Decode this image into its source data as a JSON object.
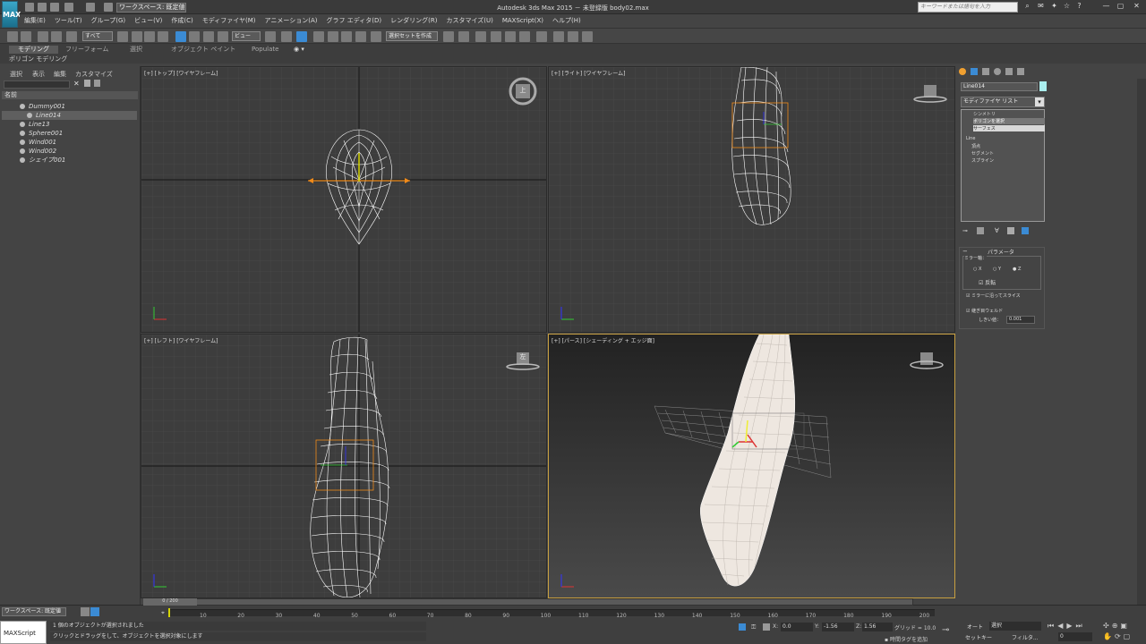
{
  "titlebar": {
    "title": "Autodesk 3ds Max  2015  －  未登録版      body02.max",
    "workspace": "ワークスペース: 既定値",
    "search_placeholder": "キーワードまたは語句を入力",
    "logo": "MAX"
  },
  "menu": [
    "編集(E)",
    "ツール(T)",
    "グループ(G)",
    "ビュー(V)",
    "作成(C)",
    "モディファイヤ(M)",
    "アニメーション(A)",
    "グラフ エディタ(D)",
    "レンダリング(R)",
    "カスタマイズ(U)",
    "MAXScript(X)",
    "ヘルプ(H)"
  ],
  "toolbar": {
    "filter": "すべて",
    "view": "ビュー",
    "selset": "選択セットを作成"
  },
  "ribbon": {
    "tabs": [
      "モデリング",
      "フリーフォーム",
      "選択",
      "オブジェクト ペイント",
      "Populate"
    ],
    "sub": "ポリゴン モデリング"
  },
  "scene": {
    "tabs": [
      "選択",
      "表示",
      "編集",
      "カスタマイズ"
    ],
    "header": "名前",
    "items": [
      {
        "name": "Dummy001"
      },
      {
        "name": "Line014"
      },
      {
        "name": "Line13"
      },
      {
        "name": "Sphere001"
      },
      {
        "name": "Wind001"
      },
      {
        "name": "Wind002"
      },
      {
        "name": "シェイプ001"
      }
    ]
  },
  "viewports": {
    "top": "[+] [トップ] [ワイヤフレーム]",
    "right": "[+] [ライト] [ワイヤフレーム]",
    "left": "[+] [レフト] [ワイヤフレーム]",
    "persp": "[+] [パース] [シェーディング + エッジ面]",
    "cube_top": "上",
    "cube_left": "左"
  },
  "cmd": {
    "objname": "Line014",
    "modlist": "モディファイヤ リスト",
    "stack": [
      "シンメトリ",
      "ポリゴンを選択",
      "サーフェス",
      "Line",
      "頂点",
      "セグメント",
      "スプライン"
    ],
    "rollout": "パラメータ",
    "axis_label": "ミラー軸：",
    "axes": [
      "X",
      "Y",
      "Z"
    ],
    "flip": "反転",
    "slice": "ミラーに沿ってスライス",
    "weld": "継ぎ目ウェルド",
    "threshold_label": "しきい値：",
    "threshold": "0.001"
  },
  "bottom": {
    "workspace": "ワークスペース: 既定値",
    "frame": "0 / 200",
    "ticks": [
      "10",
      "20",
      "30",
      "40",
      "50",
      "60",
      "70",
      "80",
      "90",
      "100",
      "110",
      "120",
      "130",
      "140",
      "150",
      "160",
      "170",
      "180",
      "190",
      "200"
    ],
    "status1": "1 個のオブジェクトが選択されました",
    "status2": "クリックとドラッグをして、オブジェクトを選択対象にします",
    "maxscript": "MAXScript 1C",
    "x": "0.0",
    "y": "-1.56",
    "z": "1.56",
    "grid": "グリッド = 10.0",
    "auto": "オート",
    "setkey": "セットキー",
    "sel": "選択",
    "filter": "フィルタ...",
    "timetag": "時間タグを追加",
    "frame_field": "0"
  },
  "colors": {
    "accent": "#f08a1a",
    "select_blue": "#3b8bd4",
    "grid": "#3a3a3a"
  }
}
